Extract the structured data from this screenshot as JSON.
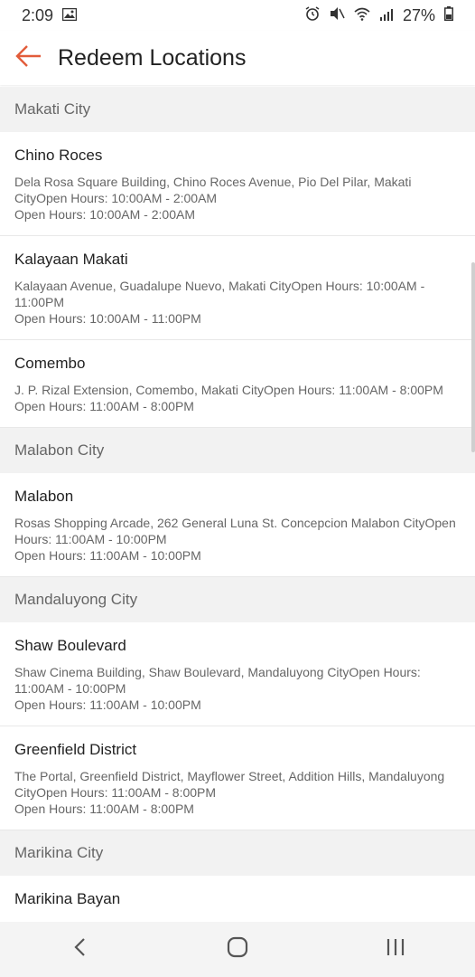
{
  "status_bar": {
    "time": "2:09",
    "battery": "27%",
    "icons": [
      "gallery-icon",
      "alarm-icon",
      "mute-icon",
      "wifi-icon",
      "signal-icon",
      "battery-icon"
    ]
  },
  "app_bar": {
    "title": "Redeem Locations",
    "back_icon": "back-arrow-icon",
    "accent_color": "#e25c3a"
  },
  "sections": [
    {
      "city": "Makati City",
      "locations": [
        {
          "name": "Chino Roces",
          "address": "Dela Rosa Square Building, Chino Roces Avenue, Pio Del Pilar, Makati CityOpen Hours: 10:00AM - 2:00AM",
          "hours": "Open Hours: 10:00AM - 2:00AM"
        },
        {
          "name": "Kalayaan Makati",
          "address": "Kalayaan Avenue, Guadalupe Nuevo, Makati CityOpen Hours: 10:00AM - 11:00PM",
          "hours": "Open Hours: 10:00AM - 11:00PM"
        },
        {
          "name": "Comembo",
          "address": "J. P. Rizal Extension, Comembo, Makati CityOpen Hours: 11:00AM - 8:00PM",
          "hours": "Open Hours: 11:00AM - 8:00PM"
        }
      ]
    },
    {
      "city": "Malabon City",
      "locations": [
        {
          "name": "Malabon",
          "address": "Rosas Shopping Arcade, 262 General Luna St. Concepcion Malabon CityOpen Hours: 11:00AM - 10:00PM",
          "hours": "Open Hours: 11:00AM - 10:00PM"
        }
      ]
    },
    {
      "city": "Mandaluyong City",
      "locations": [
        {
          "name": "Shaw Boulevard",
          "address": "Shaw Cinema Building, Shaw Boulevard, Mandaluyong CityOpen Hours: 11:00AM - 10:00PM",
          "hours": "Open Hours: 11:00AM - 10:00PM"
        },
        {
          "name": "Greenfield District",
          "address": "The Portal, Greenfield District, Mayflower Street, Addition Hills, Mandaluyong CityOpen Hours: 11:00AM - 8:00PM",
          "hours": "Open Hours: 11:00AM - 8:00PM"
        }
      ]
    },
    {
      "city": "Marikina City",
      "locations": [
        {
          "name": "Marikina Bayan",
          "address": "",
          "hours": ""
        }
      ]
    }
  ],
  "nav_bar": {
    "icons": [
      "back-nav-icon",
      "home-nav-icon",
      "recents-nav-icon"
    ]
  }
}
